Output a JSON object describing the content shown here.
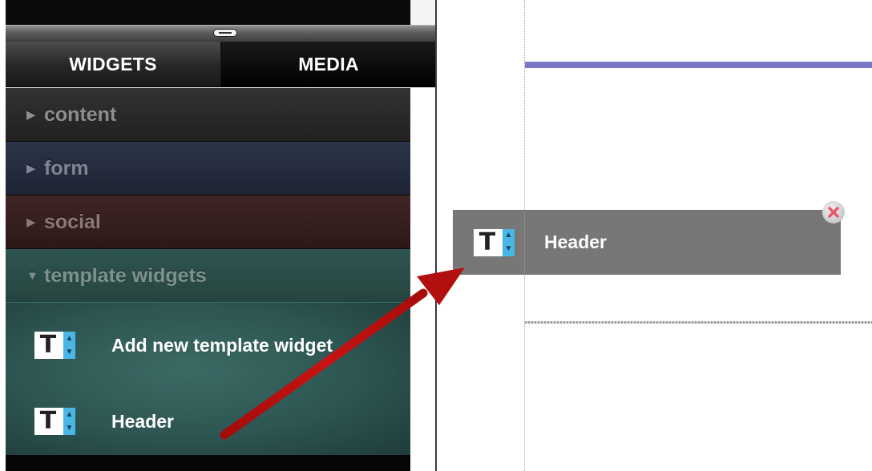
{
  "sidebar": {
    "tabs": [
      {
        "label": "WIDGETS"
      },
      {
        "label": "MEDIA"
      }
    ],
    "categories": [
      {
        "label": "content",
        "expanded": false,
        "color": "#2a2a2a"
      },
      {
        "label": "form",
        "expanded": false,
        "color": "#242c3d"
      },
      {
        "label": "social",
        "expanded": false,
        "color": "#361e1e"
      },
      {
        "label": "template widgets",
        "expanded": true,
        "color": "#2b4c48"
      }
    ],
    "template_items": [
      {
        "label": "Add new template widget",
        "icon": "text-widget-icon"
      },
      {
        "label": "Header",
        "icon": "text-widget-icon"
      }
    ]
  },
  "canvas": {
    "dragged_widget": {
      "label": "Header",
      "icon": "text-widget-icon"
    },
    "close_icon": "close-icon",
    "header_rule_color": "#7b77c9"
  },
  "icons": {
    "widget_letter": "T",
    "spinner_up": "▲",
    "spinner_down": "▼",
    "collapsed_arrow": "▶",
    "expanded_arrow": "▼"
  },
  "annotation": {
    "arrow_color": "#b00d0d"
  }
}
